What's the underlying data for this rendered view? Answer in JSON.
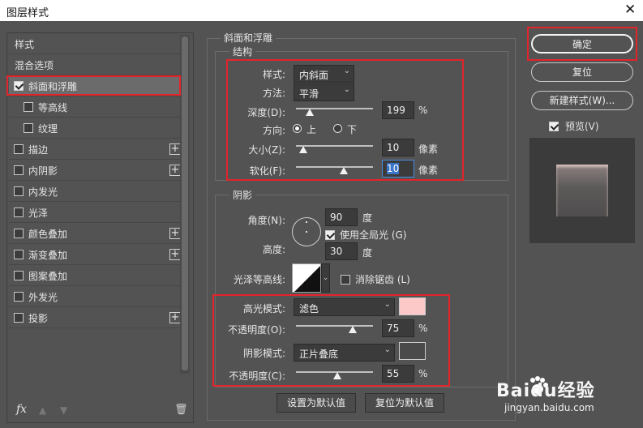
{
  "window": {
    "title": "图层样式",
    "close": "✕"
  },
  "left": {
    "items": [
      {
        "label": "样式",
        "checkbox": false,
        "plus": false
      },
      {
        "label": "混合选项",
        "checkbox": false,
        "plus": false
      },
      {
        "label": "斜面和浮雕",
        "checkbox": true,
        "checked": true,
        "plus": false
      },
      {
        "label": "等高线",
        "checkbox": true,
        "checked": false,
        "plus": false
      },
      {
        "label": "纹理",
        "checkbox": true,
        "checked": false,
        "plus": false
      },
      {
        "label": "描边",
        "checkbox": true,
        "checked": false,
        "plus": true
      },
      {
        "label": "内阴影",
        "checkbox": true,
        "checked": false,
        "plus": true
      },
      {
        "label": "内发光",
        "checkbox": true,
        "checked": false,
        "plus": false
      },
      {
        "label": "光泽",
        "checkbox": true,
        "checked": false,
        "plus": false
      },
      {
        "label": "颜色叠加",
        "checkbox": true,
        "checked": false,
        "plus": true
      },
      {
        "label": "渐变叠加",
        "checkbox": true,
        "checked": false,
        "plus": true
      },
      {
        "label": "图案叠加",
        "checkbox": true,
        "checked": false,
        "plus": false
      },
      {
        "label": "外发光",
        "checkbox": true,
        "checked": false,
        "plus": false
      },
      {
        "label": "投影",
        "checkbox": true,
        "checked": false,
        "plus": true
      }
    ],
    "fx": "fx"
  },
  "bevel": {
    "title": "斜面和浮雕",
    "structure": {
      "title": "结构",
      "style_label": "样式:",
      "style_value": "内斜面",
      "method_label": "方法:",
      "method_value": "平滑",
      "depth_label": "深度(D):",
      "depth_value": "199",
      "depth_unit": "%",
      "direction_label": "方向:",
      "dir_up": "上",
      "dir_down": "下",
      "size_label": "大小(Z):",
      "size_value": "10",
      "size_unit": "像素",
      "soften_label": "软化(F):",
      "soften_value": "10",
      "soften_unit": "像素"
    },
    "shading": {
      "title": "阴影",
      "angle_label": "角度(N):",
      "angle_value": "90",
      "angle_unit": "度",
      "global_light": "使用全局光 (G)",
      "altitude_label": "高度:",
      "altitude_value": "30",
      "altitude_unit": "度",
      "gloss_label": "光泽等高线:",
      "antialias": "消除锯齿 (L)",
      "highlight_mode_label": "高光模式:",
      "highlight_mode_value": "滤色",
      "highlight_color": "#fdc8c8",
      "highlight_opacity_label": "不透明度(O):",
      "highlight_opacity_value": "75",
      "highlight_opacity_unit": "%",
      "shadow_mode_label": "阴影模式:",
      "shadow_mode_value": "正片叠底",
      "shadow_color": "#4a4a4a",
      "shadow_opacity_label": "不透明度(C):",
      "shadow_opacity_value": "55",
      "shadow_opacity_unit": "%"
    },
    "make_default": "设置为默认值",
    "reset_default": "复位为默认值"
  },
  "right": {
    "ok": "确定",
    "reset": "复位",
    "new_style": "新建样式(W)...",
    "preview": "预览(V)"
  },
  "watermark": {
    "brand": "Baidu经验",
    "url": "jingyan.baidu.com"
  },
  "colors": {
    "accent_red": "#e3242b",
    "panel": "#535353"
  }
}
